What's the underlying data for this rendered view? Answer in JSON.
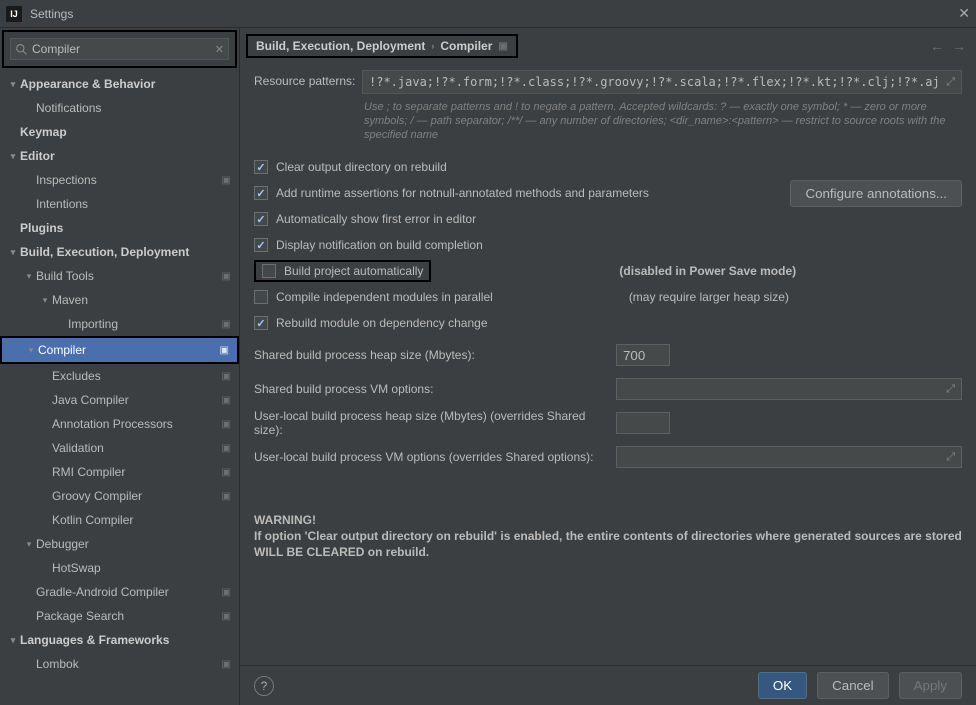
{
  "window": {
    "title": "Settings"
  },
  "search": {
    "value": "Compiler"
  },
  "tree": {
    "appearance": "Appearance & Behavior",
    "notifications": "Notifications",
    "keymap": "Keymap",
    "editor": "Editor",
    "inspections": "Inspections",
    "intentions": "Intentions",
    "plugins": "Plugins",
    "bed": "Build, Execution, Deployment",
    "buildtools": "Build Tools",
    "maven": "Maven",
    "importing": "Importing",
    "compiler": "Compiler",
    "excludes": "Excludes",
    "javacompiler": "Java Compiler",
    "annproc": "Annotation Processors",
    "validation": "Validation",
    "rmi": "RMI Compiler",
    "groovy": "Groovy Compiler",
    "kotlin": "Kotlin Compiler",
    "debugger": "Debugger",
    "hotswap": "HotSwap",
    "gradleandroid": "Gradle-Android Compiler",
    "pkgsearch": "Package Search",
    "langfw": "Languages & Frameworks",
    "lombok": "Lombok"
  },
  "breadcrumb": {
    "a": "Build, Execution, Deployment",
    "b": "Compiler"
  },
  "patterns": {
    "label": "Resource patterns:",
    "value": "!?*.java;!?*.form;!?*.class;!?*.groovy;!?*.scala;!?*.flex;!?*.kt;!?*.clj;!?*.aj",
    "hint": "Use ; to separate patterns and ! to negate a pattern. Accepted wildcards: ? — exactly one symbol; * — zero or more symbols; / — path separator; /**/ — any number of directories; <dir_name>:<pattern> — restrict to source roots with the specified name"
  },
  "checks": {
    "clear": "Clear output directory on rebuild",
    "assertions": "Add runtime assertions for notnull-annotated methods and parameters",
    "configure": "Configure annotations...",
    "firsterror": "Automatically show first error in editor",
    "notify": "Display notification on build completion",
    "autobuild": "Build project automatically",
    "autobuild_note": "(disabled in Power Save mode)",
    "parallel": "Compile independent modules in parallel",
    "parallel_note": "(may require larger heap size)",
    "rebuilddep": "Rebuild module on dependency change"
  },
  "fields": {
    "sharedheap_label": "Shared build process heap size (Mbytes):",
    "sharedheap_value": "700",
    "sharedvm_label": "Shared build process VM options:",
    "sharedvm_value": "",
    "userheap_label": "User-local build process heap size (Mbytes) (overrides Shared size):",
    "userheap_value": "",
    "uservm_label": "User-local build process VM options (overrides Shared options):",
    "uservm_value": ""
  },
  "warning": {
    "title": "WARNING!",
    "body": "If option 'Clear output directory on rebuild' is enabled, the entire contents of directories where generated sources are stored WILL BE CLEARED on rebuild."
  },
  "buttons": {
    "ok": "OK",
    "cancel": "Cancel",
    "apply": "Apply"
  }
}
